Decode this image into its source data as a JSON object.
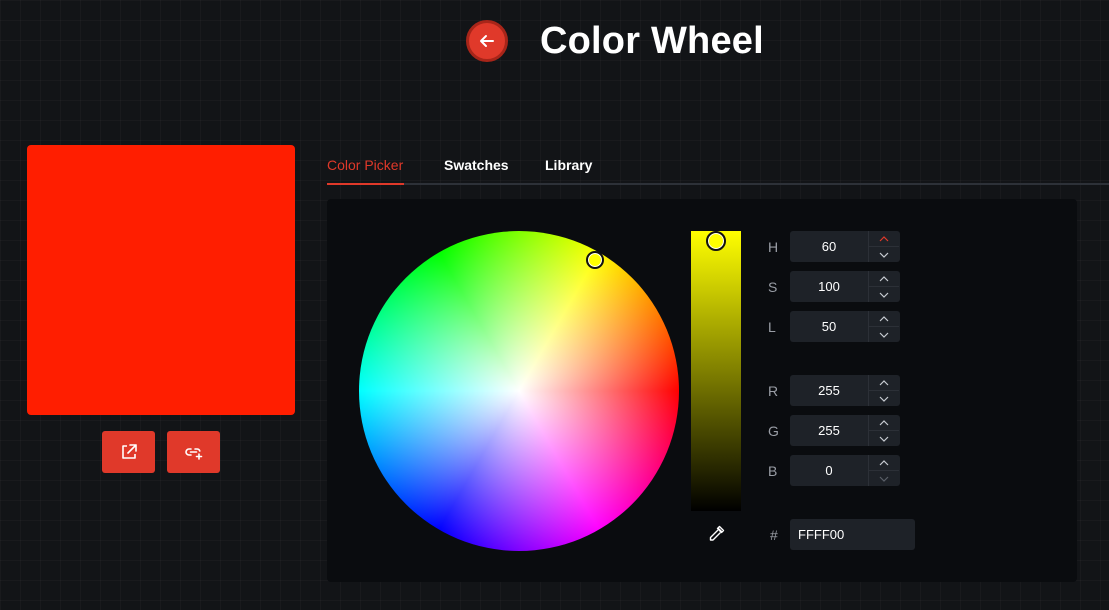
{
  "header": {
    "title": "Color Wheel",
    "back_icon": "arrow-left-icon"
  },
  "preview": {
    "color": "#ff1e00"
  },
  "actions": [
    {
      "name": "share-button",
      "icon": "share-icon"
    },
    {
      "name": "link-button",
      "icon": "link-add-icon"
    }
  ],
  "tabs": [
    {
      "label": "Color Picker",
      "active": true
    },
    {
      "label": "Swatches",
      "active": false
    },
    {
      "label": "Library",
      "active": false
    }
  ],
  "colors": {
    "accent": "#e0392a",
    "selected": "#ffff00",
    "panel": "#0a0c0f",
    "input": "#1e2228"
  },
  "hsl": {
    "h": {
      "label": "H",
      "value": "60"
    },
    "s": {
      "label": "S",
      "value": "100"
    },
    "l": {
      "label": "L",
      "value": "50"
    }
  },
  "rgb": {
    "r": {
      "label": "R",
      "value": "255"
    },
    "g": {
      "label": "G",
      "value": "255"
    },
    "b": {
      "label": "B",
      "value": "0"
    }
  },
  "hex": {
    "label": "#",
    "value": "FFFF00"
  }
}
